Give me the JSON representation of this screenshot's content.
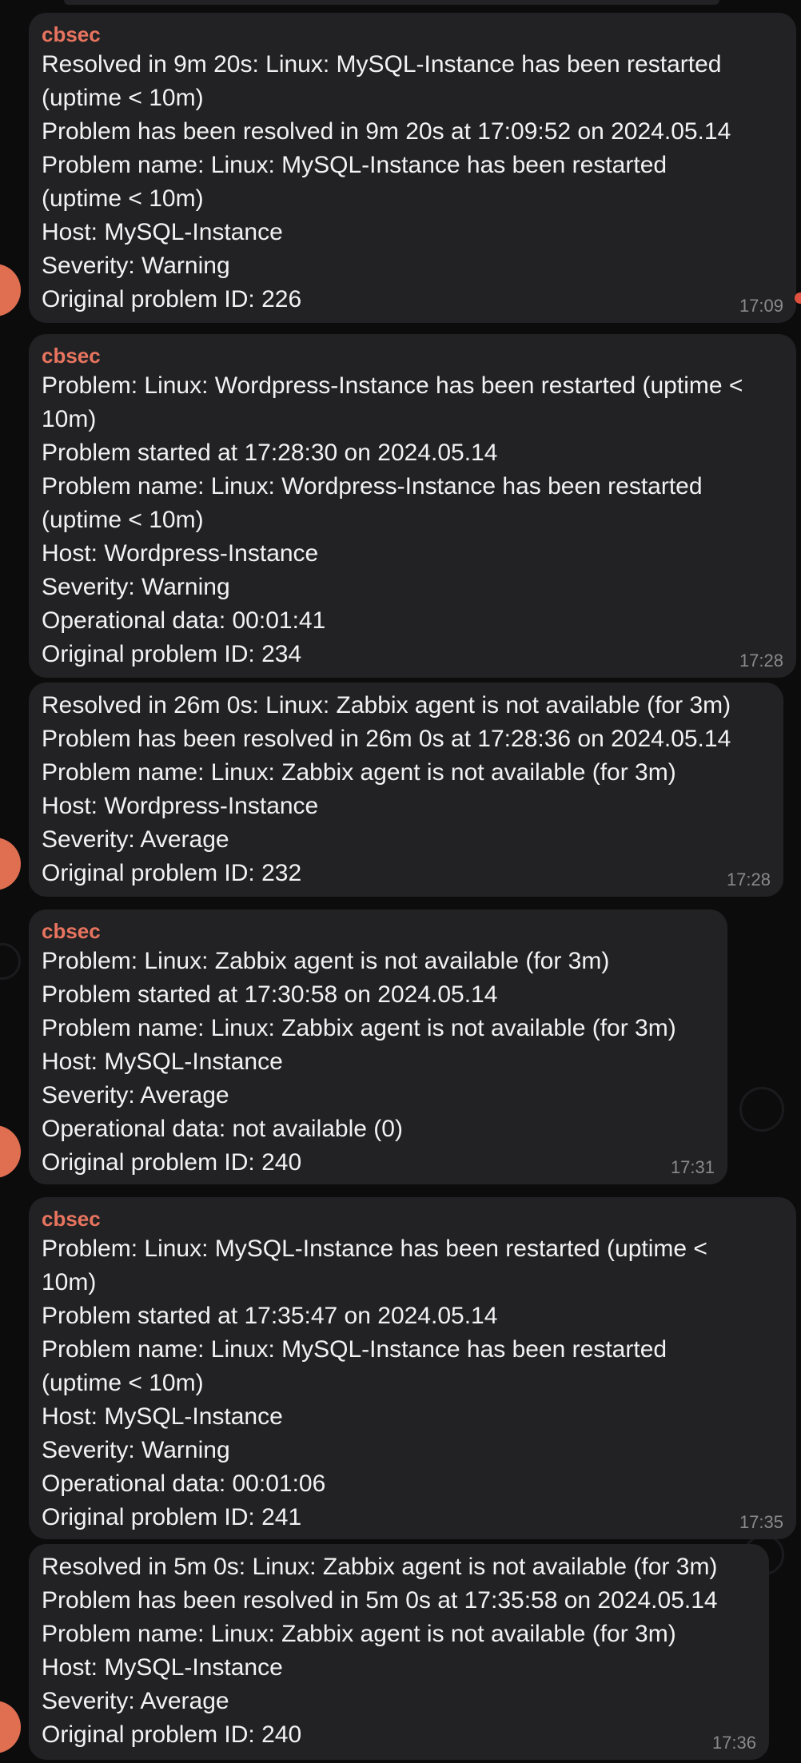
{
  "messages": [
    {
      "sender": "cbsec",
      "lines": [
        "Resolved in 9m 20s: Linux: MySQL-Instance has been restarted",
        "(uptime < 10m)",
        "Problem has been resolved in 9m 20s at 17:09:52 on 2024.05.14",
        "Problem name: Linux: MySQL-Instance has been restarted",
        "(uptime < 10m)",
        "Host: MySQL-Instance",
        "Severity: Warning",
        "Original problem ID: 226"
      ],
      "time": "17:09"
    },
    {
      "sender": "cbsec",
      "lines": [
        "Problem: Linux: Wordpress-Instance has been restarted (uptime <",
        "10m)",
        "Problem started at 17:28:30 on 2024.05.14",
        "Problem name: Linux: Wordpress-Instance has been restarted",
        "(uptime < 10m)",
        "Host: Wordpress-Instance",
        "Severity: Warning",
        "Operational data: 00:01:41",
        "Original problem ID: 234"
      ],
      "time": "17:28"
    },
    {
      "sender": "",
      "lines": [
        "Resolved in 26m 0s: Linux: Zabbix agent is not available (for 3m)",
        "Problem has been resolved in 26m 0s at 17:28:36 on 2024.05.14",
        "Problem name: Linux: Zabbix agent is not available (for 3m)",
        "Host: Wordpress-Instance",
        "Severity: Average",
        "Original problem ID: 232"
      ],
      "time": "17:28"
    },
    {
      "sender": "cbsec",
      "lines": [
        "Problem: Linux: Zabbix agent is not available (for 3m)",
        "Problem started at 17:30:58 on 2024.05.14",
        "Problem name: Linux: Zabbix agent is not available (for 3m)",
        "Host: MySQL-Instance",
        "Severity: Average",
        "Operational data: not available (0)",
        "Original problem ID: 240"
      ],
      "time": "17:31"
    },
    {
      "sender": "cbsec",
      "lines": [
        "Problem: Linux: MySQL-Instance has been restarted (uptime <",
        "10m)",
        "Problem started at 17:35:47 on 2024.05.14",
        "Problem name: Linux: MySQL-Instance has been restarted",
        "(uptime < 10m)",
        "Host: MySQL-Instance",
        "Severity: Warning",
        "Operational data: 00:01:06",
        "Original problem ID: 241"
      ],
      "time": "17:35"
    },
    {
      "sender": "",
      "lines": [
        "Resolved in 5m 0s: Linux: Zabbix agent is not available (for 3m)",
        "Problem has been resolved in 5m 0s at 17:35:58 on 2024.05.14",
        "Problem name: Linux: Zabbix agent is not available (for 3m)",
        "Host: MySQL-Instance",
        "Severity: Average",
        "Original problem ID: 240"
      ],
      "time": "17:36"
    }
  ],
  "colors": {
    "background": "#0c0c0d",
    "bubble": "#222224",
    "sender_name": "#e8745f",
    "avatar": "#e06f52",
    "timestamp": "#8a8a8e",
    "text": "#f2f2f2"
  }
}
